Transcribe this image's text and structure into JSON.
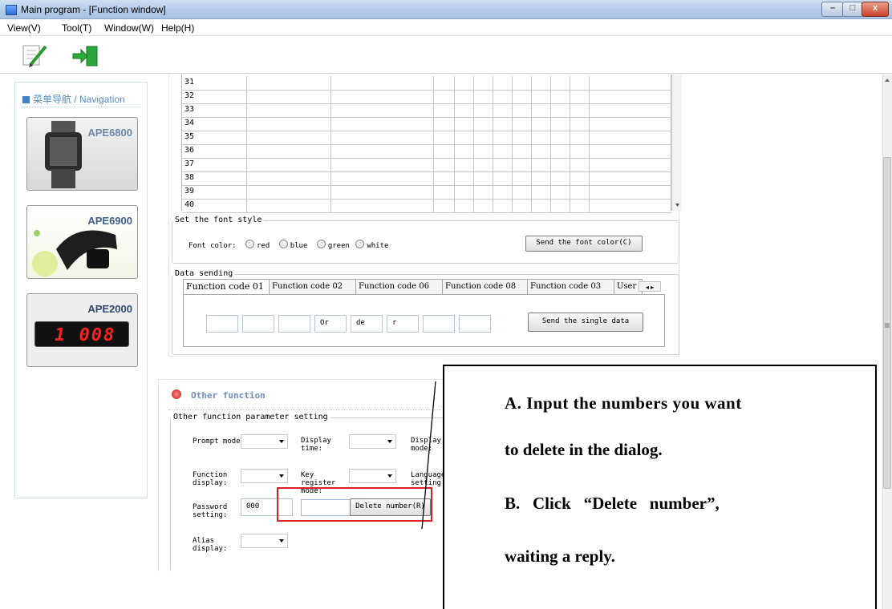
{
  "window": {
    "title": "Main program - [Function window]",
    "min": "–",
    "max": "□",
    "close": "x"
  },
  "menu": [
    "View(V)",
    "Tool(T)",
    "Window(W)",
    "Help(H)"
  ],
  "nav": {
    "title_cn": "菜单导航",
    "title_en": " / Navigation",
    "cards": [
      {
        "label": "APE6800"
      },
      {
        "label": "APE6900"
      },
      {
        "label": "APE2000",
        "display": "1 008"
      }
    ]
  },
  "grid": {
    "rows": [
      "31",
      "32",
      "33",
      "34",
      "35",
      "36",
      "37",
      "38",
      "39",
      "40"
    ]
  },
  "font_style": {
    "group_label": "Set the font style",
    "prefix": "Font color:",
    "options": [
      "red",
      "blue",
      "green",
      "white"
    ],
    "send_button": "Send the font color(C)"
  },
  "data_sending": {
    "group_label": "Data sending",
    "tabs": [
      "Function code 01",
      "Function code 02",
      "Function code 06",
      "Function code 08",
      "Function code 03",
      "User"
    ],
    "fields": [
      "",
      "",
      "",
      "Or",
      "de",
      "r",
      "",
      ""
    ],
    "send_button": "Send the single data"
  },
  "other_function": {
    "title": "Other function",
    "group_label": "Other function parameter setting",
    "labels": {
      "prompt_mode": "Prompt mode:",
      "display_time": "Display time:",
      "display_mode": "Display mode:",
      "function_display": "Function display:",
      "key_register_mode": "Key register mode:",
      "language_setting": "Language setting",
      "password_setting": "Password setting:",
      "alias_display": "Alias display:"
    },
    "password_value": "000",
    "delete_field_value": "",
    "delete_button": "Delete number(R)"
  },
  "callout": {
    "line1": "A. Input the numbers you want",
    "line2": "to delete in the dialog.",
    "line3": "B.   Click   “Delete   number”,",
    "line4": "waiting a reply."
  },
  "colors": {
    "highlight_box": "#e02020",
    "accent": "#3d82c6"
  }
}
